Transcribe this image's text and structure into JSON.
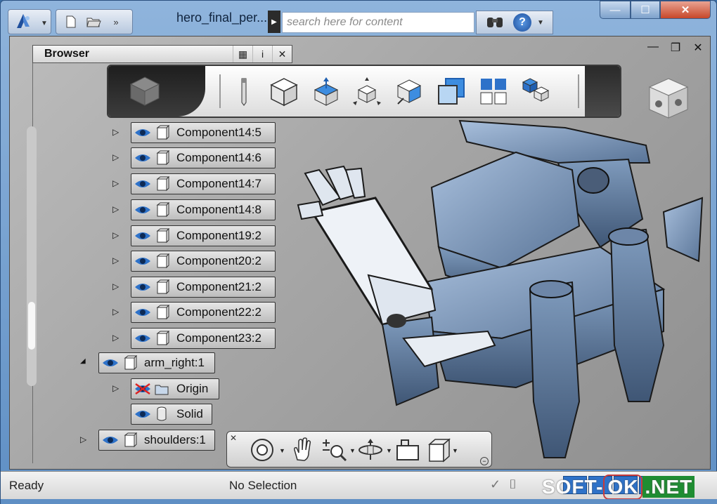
{
  "window": {
    "doc_title": "hero_final_per...",
    "search_placeholder": "search here for content",
    "help_label": "?",
    "controls": {
      "minimize": "—",
      "maximize": "☐",
      "close": "✕"
    }
  },
  "browser": {
    "title": "Browser",
    "header_buttons": [
      "▦",
      "i",
      "✕"
    ]
  },
  "viewport_controls": {
    "minimize": "—",
    "restore": "❐",
    "close": "✕"
  },
  "tree": {
    "components": [
      "Component14:5",
      "Component14:6",
      "Component14:7",
      "Component14:8",
      "Component19:2",
      "Component20:2",
      "Component21:2",
      "Component22:2",
      "Component23:2"
    ],
    "arm_right": "arm_right:1",
    "origin": "Origin",
    "solid": "Solid",
    "shoulders": "shoulders:1",
    "expand_collapsed": "▷",
    "expand_open": "◢"
  },
  "toolbar": {
    "tools": [
      "pencil",
      "box",
      "extrude-up",
      "move-3d",
      "box-edit",
      "overlap-squares",
      "tile-grid",
      "pattern-cubes"
    ]
  },
  "navbar": {
    "close": "✕",
    "collapse": "⊖",
    "tools": [
      "steering-wheel",
      "pan",
      "zoom",
      "orbit",
      "look-at",
      "view-cube"
    ]
  },
  "status": {
    "ready": "Ready",
    "selection": "No Selection"
  },
  "watermark": {
    "part1": "SOFT-",
    "part2": "OK",
    "part3": ".NET"
  },
  "colors": {
    "title_bar": "#7ea7d6",
    "viewport_bg": "#a8a8a8",
    "model_blue": "#7f9bbd",
    "selection_blue": "#2e72c9"
  }
}
